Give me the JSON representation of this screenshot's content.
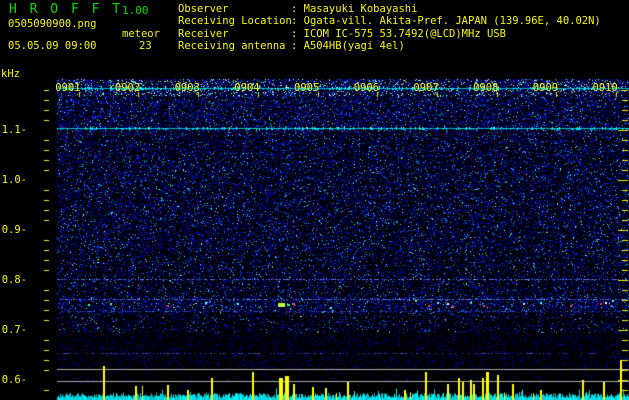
{
  "header": {
    "app_title": "H R O F F T",
    "version": "1.00",
    "filename": "0505090900.png",
    "mode_label": "meteor",
    "datetime": "05.05.09 09:00",
    "echo_count": "23",
    "info_rows": [
      {
        "label": "Observer",
        "value": "Masayuki Kobayashi"
      },
      {
        "label": "Receiving Location",
        "value": "Ogata-vill. Akita-Pref. JAPAN (139.96E, 40.02N)"
      },
      {
        "label": "Receiver",
        "value": "ICOM IC-575 53.7492(@LCD)MHz USB"
      },
      {
        "label": "Receiving antenna",
        "value": "A504HB(yagi 4el)"
      }
    ]
  },
  "chart_data": {
    "type": "heatmap",
    "title": "HROFFT 10-minute radio meteor echo spectrogram with signal-level strip",
    "x_axis": {
      "start": "09:00",
      "end": "09:10",
      "tick_labels": [
        "0901",
        "0902",
        "0903",
        "0904",
        "0905",
        "0906",
        "0907",
        "0908",
        "0909",
        "0910"
      ],
      "tick_interval_min": 1
    },
    "y_axis": {
      "unit_label": "kHz",
      "tick_labels": [
        "1.1",
        "1.0",
        "0.9",
        "0.8",
        "0.7",
        "0.6"
      ],
      "minor_step_khz": 0.02,
      "visible_range_khz": [
        0.58,
        1.2
      ]
    },
    "colors": {
      "axis_text": "#f6f600",
      "tick": "#f0f000",
      "noise_base": "#0000aa",
      "trace": "#00e8e8",
      "spike": "#ffff00",
      "reference_line": "#a8a8a8",
      "background": "#000000"
    },
    "carrier_lines": [
      {
        "khz": 1.184,
        "color": "#00ffee",
        "strength": "bright"
      },
      {
        "khz": 1.105,
        "color": "#00ffcc",
        "strength": "bright"
      },
      {
        "khz": 0.802,
        "color": "#8899ee",
        "strength": "faint"
      },
      {
        "khz": 0.762,
        "color": "#4466dd",
        "strength": "faint"
      },
      {
        "khz": 0.738,
        "color": "#3355cc",
        "strength": "very-faint"
      },
      {
        "khz": 0.655,
        "color": "#2244bb",
        "strength": "very-faint"
      }
    ],
    "echo_band_khz": [
      0.736,
      0.766
    ],
    "echoes": [
      {
        "min": 1.16,
        "khz": 0.752,
        "color": "#44ffff",
        "size": 2
      },
      {
        "min": 1.52,
        "khz": 0.754,
        "color": "#44ff77",
        "size": 2
      },
      {
        "min": 2.48,
        "khz": 0.75,
        "color": "#ff3333",
        "size": 2
      },
      {
        "min": 3.12,
        "khz": 0.756,
        "color": "#44ffff",
        "size": 2
      },
      {
        "min": 3.65,
        "khz": 0.754,
        "color": "#66ffff",
        "size": 2
      },
      {
        "min": 4.34,
        "khz": 0.754,
        "color": "#bbff44",
        "size": 7
      },
      {
        "min": 4.49,
        "khz": 0.752,
        "color": "#44ff77",
        "size": 3
      },
      {
        "min": 4.57,
        "khz": 0.754,
        "color": "#ff4444",
        "size": 3
      },
      {
        "min": 5.21,
        "khz": 0.746,
        "color": "#44ffff",
        "size": 2
      },
      {
        "min": 6.63,
        "khz": 0.76,
        "color": "#44ff77",
        "size": 2
      },
      {
        "min": 6.85,
        "khz": 0.75,
        "color": "#ff3333",
        "size": 2
      },
      {
        "min": 7.0,
        "khz": 0.756,
        "color": "#66ffff",
        "size": 2
      },
      {
        "min": 7.17,
        "khz": 0.754,
        "color": "#ffffff",
        "size": 2
      },
      {
        "min": 7.25,
        "khz": 0.748,
        "color": "#ff4444",
        "size": 2
      },
      {
        "min": 7.55,
        "khz": 0.756,
        "color": "#44ff77",
        "size": 2
      },
      {
        "min": 7.77,
        "khz": 0.75,
        "color": "#ff3333",
        "size": 2
      },
      {
        "min": 8.44,
        "khz": 0.754,
        "color": "#66ffff",
        "size": 2
      },
      {
        "min": 8.73,
        "khz": 0.756,
        "color": "#44ffff",
        "size": 2
      },
      {
        "min": 9.23,
        "khz": 0.75,
        "color": "#ff4444",
        "size": 2
      },
      {
        "min": 9.73,
        "khz": 0.754,
        "color": "#ff3333",
        "size": 2
      },
      {
        "min": 9.82,
        "khz": 0.756,
        "color": "#ffffff",
        "size": 2
      },
      {
        "min": 9.93,
        "khz": 0.76,
        "color": "#44ffff",
        "size": 2
      }
    ],
    "reference_lines_khz": [
      0.622,
      0.599
    ],
    "level_strip": {
      "spikes": [
        {
          "min": 1.41,
          "level": 0.85
        },
        {
          "min": 1.94,
          "level": 0.35
        },
        {
          "min": 2.48,
          "level": 0.38
        },
        {
          "min": 2.81,
          "level": 0.25
        },
        {
          "min": 3.22,
          "level": 0.55
        },
        {
          "min": 3.9,
          "level": 0.7
        },
        {
          "min": 4.36,
          "level": 0.55,
          "w": 4
        },
        {
          "min": 4.46,
          "level": 0.6,
          "w": 4
        },
        {
          "min": 4.59,
          "level": 0.4
        },
        {
          "min": 4.91,
          "level": 0.33
        },
        {
          "min": 5.13,
          "level": 0.3
        },
        {
          "min": 5.49,
          "level": 0.45
        },
        {
          "min": 6.45,
          "level": 0.25
        },
        {
          "min": 6.8,
          "level": 0.7
        },
        {
          "min": 7.17,
          "level": 0.4
        },
        {
          "min": 7.35,
          "level": 0.55
        },
        {
          "min": 7.42,
          "level": 0.45
        },
        {
          "min": 7.55,
          "level": 0.5
        },
        {
          "min": 7.6,
          "level": 0.4
        },
        {
          "min": 7.76,
          "level": 0.55
        },
        {
          "min": 7.82,
          "level": 0.7,
          "w": 3
        },
        {
          "min": 8.01,
          "level": 0.63
        },
        {
          "min": 8.26,
          "level": 0.4
        },
        {
          "min": 8.73,
          "level": 0.25
        },
        {
          "min": 9.43,
          "level": 0.5
        },
        {
          "min": 9.78,
          "level": 0.45
        },
        {
          "min": 10.07,
          "level": 1.0
        }
      ]
    }
  }
}
